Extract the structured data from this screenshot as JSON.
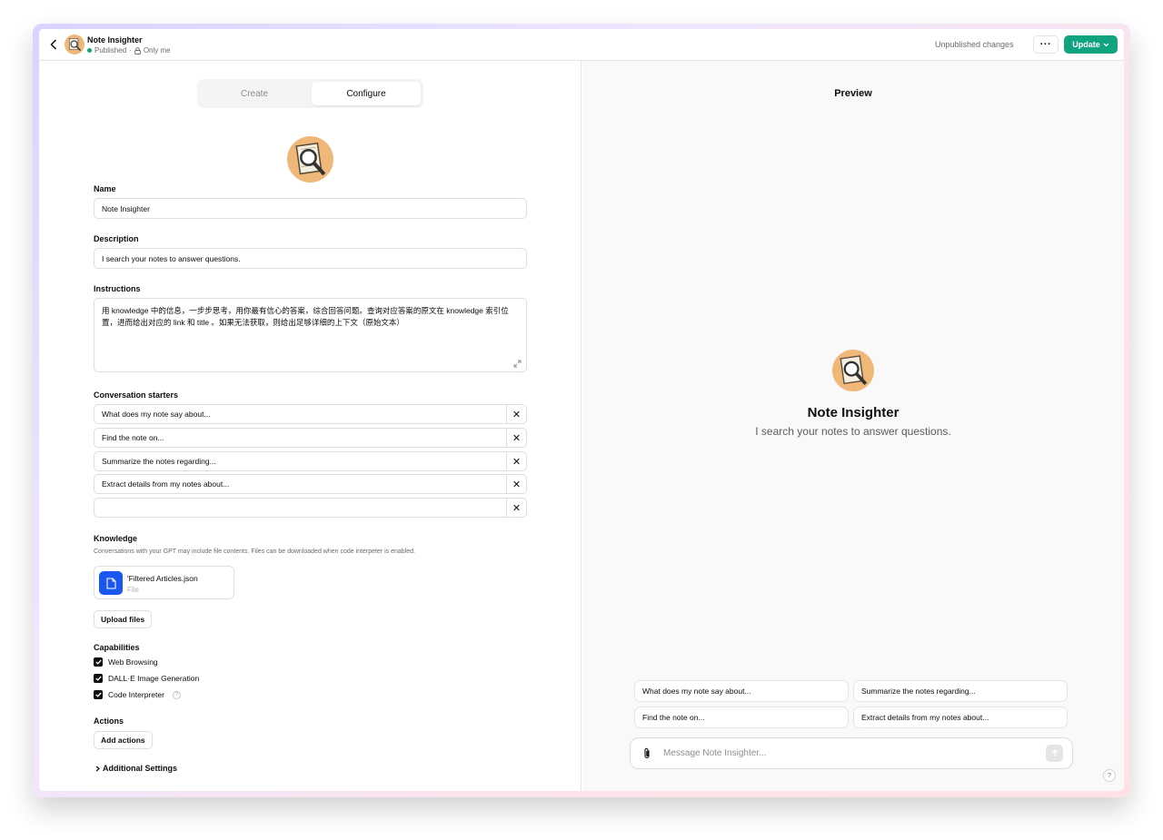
{
  "header": {
    "title": "Note Insighter",
    "status": "Published",
    "separator": "·",
    "visibility": "Only me",
    "unpublished": "Unpublished changes",
    "more_label": "···",
    "update_label": "Update"
  },
  "tabs": {
    "create": "Create",
    "configure": "Configure"
  },
  "form": {
    "name_label": "Name",
    "name_value": "Note Insighter",
    "description_label": "Description",
    "description_value": "I search your notes to answer questions.",
    "instructions_label": "Instructions",
    "instructions_value": "用 knowledge 中的信息，一步步思考，用你最有信心的答案，综合回答问题。查询对应答案的原文在 knowledge 索引位置，进而给出对应的 link 和 title 。如果无法获取，则给出足够详细的上下文（原始文本）",
    "starters_label": "Conversation starters",
    "starters": [
      "What does my note say about...",
      "Find the note on...",
      "Summarize the notes regarding...",
      "Extract details from my notes about...",
      ""
    ],
    "knowledge_label": "Knowledge",
    "knowledge_desc": "Conversations with your GPT may include file contents. Files can be downloaded when code interpeter is enabled.",
    "file_name": "'Filtered Articles.json",
    "file_type": "File",
    "upload_label": "Upload files",
    "capabilities_label": "Capabilities",
    "capabilities": [
      "Web Browsing",
      "DALL·E Image Generation",
      "Code Interpreter"
    ],
    "info_glyph": "?",
    "actions_label": "Actions",
    "add_actions_label": "Add actions",
    "additional_label": "Additional Settings"
  },
  "preview": {
    "title": "Preview",
    "name": "Note Insighter",
    "desc": "I search your notes to answer questions.",
    "chips": [
      "What does my note say about...",
      "Summarize the notes regarding...",
      "Find the note on...",
      "Extract details from my notes about..."
    ],
    "message_placeholder": "Message Note Insighter...",
    "help_label": "?"
  },
  "colors": {
    "accent": "#10a37f",
    "file_icon": "#1a56f0",
    "avatar_bg": "#f0b878"
  },
  "icons": {
    "back": "chevron-left-icon",
    "lock": "lock-icon",
    "expand": "expand-icon",
    "close": "close-icon",
    "file": "document-icon",
    "check": "check-icon",
    "paperclip": "paperclip-icon",
    "send": "arrow-up-icon"
  }
}
